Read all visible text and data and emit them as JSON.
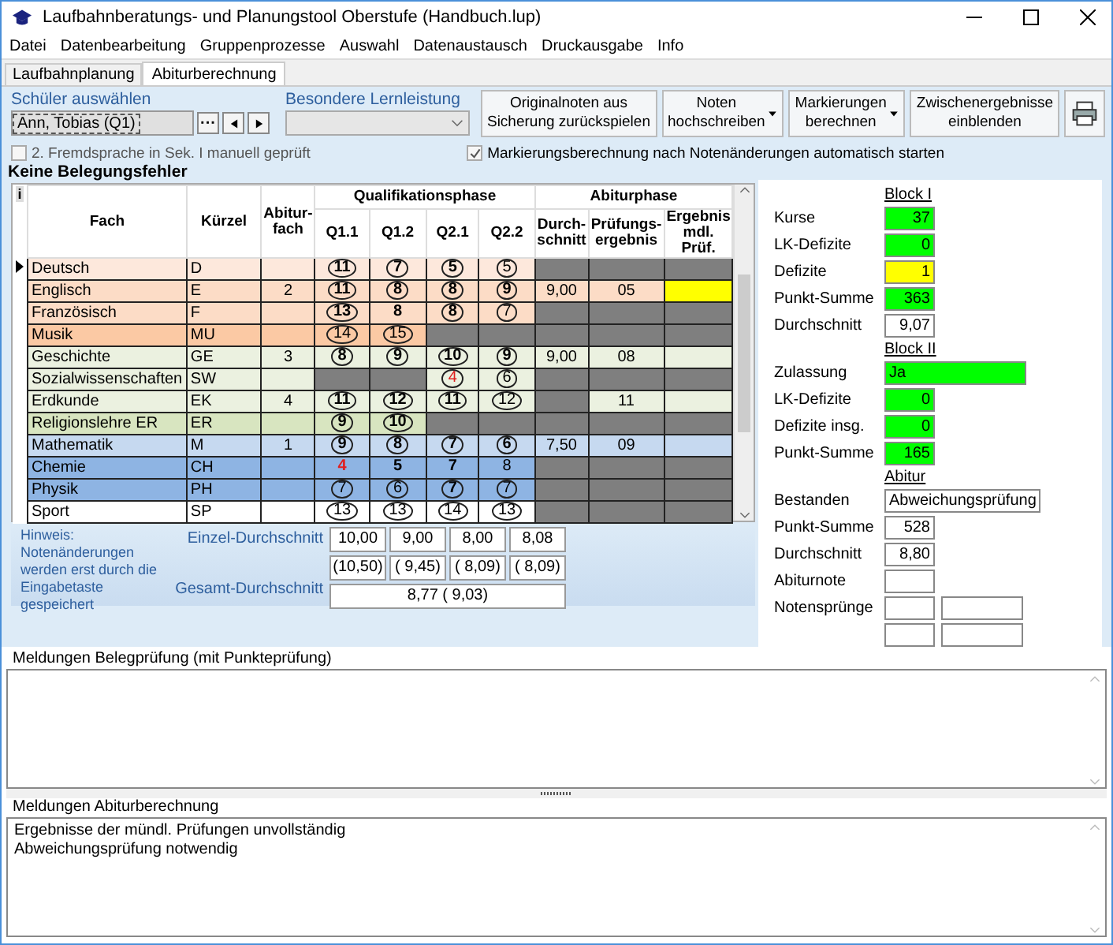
{
  "window": {
    "title": "Laufbahnberatungs- und Planungstool Oberstufe (Handbuch.lup)"
  },
  "menu": [
    "Datei",
    "Datenbearbeitung",
    "Gruppenprozesse",
    "Auswahl",
    "Datenaustausch",
    "Druckausgabe",
    "Info"
  ],
  "tabs": [
    {
      "label": "Laufbahnplanung",
      "selected": false
    },
    {
      "label": "Abiturberechnung",
      "selected": true
    }
  ],
  "student": {
    "label": "Schüler auswählen",
    "value": "Ann, Tobias (Q1)",
    "browse": "···"
  },
  "lernleistung": {
    "label": "Besondere Lernleistung",
    "disabled": true
  },
  "fremdsprache": {
    "label": "2. Fremdsprache in Sek. I manuell geprüft",
    "checked": false
  },
  "auto_calc": {
    "label": "Markierungsberechnung nach Notenänderungen automatisch starten",
    "checked": true
  },
  "buttons": [
    {
      "lines": [
        "Originalnoten aus",
        "Sicherung zurückspielen"
      ],
      "dropdown": false
    },
    {
      "lines": [
        "Noten",
        "hochschreiben"
      ],
      "dropdown": true
    },
    {
      "lines": [
        "Markierungen",
        "berechnen"
      ],
      "dropdown": true
    },
    {
      "lines": [
        "Zwischenergebnisse",
        "einblenden"
      ],
      "dropdown": false
    }
  ],
  "status": "Keine Belegungsfehler",
  "table": {
    "corner": "i",
    "columns": {
      "fach": "Fach",
      "kuerzel": "Kürzel",
      "abitur_fach": "Abitur-fach",
      "qphase": "Qualifikationsphase",
      "terms": [
        "Q1.1",
        "Q1.2",
        "Q2.1",
        "Q2.2"
      ],
      "aphase": "Abiturphase",
      "durchschnitt": "Durch-schnitt",
      "pruefung": "Prüfungs-ergebnis",
      "mdl": "Ergebnis mdl. Prüf."
    },
    "rows": [
      {
        "fach": "Deutsch",
        "kuerzel": "D",
        "color": "#fde8dc",
        "current": true,
        "grades": [
          {
            "kind": "grade",
            "value": "11",
            "circled": true,
            "bold": true,
            "deficit": false
          },
          {
            "kind": "grade",
            "value": "7",
            "circled": true,
            "bold": true,
            "deficit": false
          },
          {
            "kind": "grade",
            "value": "5",
            "circled": true,
            "bold": true,
            "deficit": false
          },
          {
            "kind": "grade",
            "value": "5",
            "circled": true,
            "bold": false,
            "deficit": false
          }
        ]
      },
      {
        "fach": "Englisch",
        "kuerzel": "E",
        "abitur_fach": "2",
        "color": "#fcdcc6",
        "current": false,
        "grades": [
          {
            "kind": "grade",
            "value": "11",
            "circled": true,
            "bold": true,
            "deficit": false
          },
          {
            "kind": "grade",
            "value": "8",
            "circled": true,
            "bold": true,
            "deficit": false
          },
          {
            "kind": "grade",
            "value": "8",
            "circled": true,
            "bold": true,
            "deficit": false
          },
          {
            "kind": "grade",
            "value": "9",
            "circled": true,
            "bold": true,
            "deficit": false
          }
        ],
        "abitur": {
          "durchschnitt": "9,00",
          "pruefung": "05",
          "mdl_required": true
        }
      },
      {
        "fach": "Französisch",
        "kuerzel": "F",
        "color": "#fcdcc6",
        "current": false,
        "grades": [
          {
            "kind": "grade",
            "value": "13",
            "circled": true,
            "bold": true,
            "deficit": false
          },
          {
            "kind": "grade",
            "value": "8",
            "circled": false,
            "bold": true,
            "deficit": false
          },
          {
            "kind": "grade",
            "value": "8",
            "circled": true,
            "bold": true,
            "deficit": false
          },
          {
            "kind": "grade",
            "value": "7",
            "circled": true,
            "bold": false,
            "deficit": false
          }
        ]
      },
      {
        "fach": "Musik",
        "kuerzel": "MU",
        "color": "#fbc9a4",
        "current": false,
        "grades": [
          {
            "kind": "grade",
            "value": "14",
            "circled": true,
            "bold": false,
            "deficit": false
          },
          {
            "kind": "grade",
            "value": "15",
            "circled": true,
            "bold": false,
            "deficit": false
          },
          {
            "kind": "blank"
          },
          {
            "kind": "blank"
          }
        ]
      },
      {
        "fach": "Geschichte",
        "kuerzel": "GE",
        "abitur_fach": "3",
        "color": "#ebf1e0",
        "current": false,
        "grades": [
          {
            "kind": "grade",
            "value": "8",
            "circled": true,
            "bold": true,
            "deficit": false
          },
          {
            "kind": "grade",
            "value": "9",
            "circled": true,
            "bold": true,
            "deficit": false
          },
          {
            "kind": "grade",
            "value": "10",
            "circled": true,
            "bold": true,
            "deficit": false
          },
          {
            "kind": "grade",
            "value": "9",
            "circled": true,
            "bold": true,
            "deficit": false
          }
        ],
        "abitur": {
          "durchschnitt": "9,00",
          "pruefung": "08",
          "mdl_required": false
        }
      },
      {
        "fach": "Sozialwissenschaften",
        "kuerzel": "SW",
        "color": "#ebf1e0",
        "current": false,
        "grades": [
          {
            "kind": "blank"
          },
          {
            "kind": "blank"
          },
          {
            "kind": "grade",
            "value": "4",
            "circled": true,
            "bold": false,
            "deficit": true
          },
          {
            "kind": "grade",
            "value": "6",
            "circled": true,
            "bold": false,
            "deficit": false
          }
        ]
      },
      {
        "fach": "Erdkunde",
        "kuerzel": "EK",
        "abitur_fach": "4",
        "color": "#ebf1e0",
        "current": false,
        "grades": [
          {
            "kind": "grade",
            "value": "11",
            "circled": true,
            "bold": true,
            "deficit": false
          },
          {
            "kind": "grade",
            "value": "12",
            "circled": true,
            "bold": true,
            "deficit": false
          },
          {
            "kind": "grade",
            "value": "11",
            "circled": true,
            "bold": true,
            "deficit": false
          },
          {
            "kind": "grade",
            "value": "12",
            "circled": true,
            "bold": false,
            "deficit": false
          }
        ],
        "abitur": {
          "pruefung": "11",
          "mdl_required": false
        }
      },
      {
        "fach": "Religionslehre ER",
        "kuerzel": "ER",
        "color": "#d8e5c0",
        "current": false,
        "grades": [
          {
            "kind": "grade",
            "value": "9",
            "circled": true,
            "bold": true,
            "deficit": false
          },
          {
            "kind": "grade",
            "value": "10",
            "circled": true,
            "bold": true,
            "deficit": false
          },
          {
            "kind": "blank"
          },
          {
            "kind": "blank"
          }
        ]
      },
      {
        "fach": "Mathematik",
        "kuerzel": "M",
        "abitur_fach": "1",
        "color": "#c6d9f0",
        "current": false,
        "grades": [
          {
            "kind": "grade",
            "value": "9",
            "circled": true,
            "bold": true,
            "deficit": false
          },
          {
            "kind": "grade",
            "value": "8",
            "circled": true,
            "bold": true,
            "deficit": false
          },
          {
            "kind": "grade",
            "value": "7",
            "circled": true,
            "bold": true,
            "deficit": false
          },
          {
            "kind": "grade",
            "value": "6",
            "circled": true,
            "bold": true,
            "deficit": false
          }
        ],
        "abitur": {
          "durchschnitt": "7,50",
          "pruefung": "09",
          "mdl_required": false
        }
      },
      {
        "fach": "Chemie",
        "kuerzel": "CH",
        "color": "#8eb4e3",
        "current": false,
        "grades": [
          {
            "kind": "grade",
            "value": "4",
            "circled": false,
            "bold": true,
            "deficit": true
          },
          {
            "kind": "grade",
            "value": "5",
            "circled": false,
            "bold": true,
            "deficit": false
          },
          {
            "kind": "grade",
            "value": "7",
            "circled": false,
            "bold": true,
            "deficit": false
          },
          {
            "kind": "grade",
            "value": "8",
            "circled": false,
            "bold": false,
            "deficit": false
          }
        ]
      },
      {
        "fach": "Physik",
        "kuerzel": "PH",
        "color": "#8eb4e3",
        "current": false,
        "grades": [
          {
            "kind": "grade",
            "value": "7",
            "circled": true,
            "bold": false,
            "deficit": false
          },
          {
            "kind": "grade",
            "value": "6",
            "circled": true,
            "bold": false,
            "deficit": false
          },
          {
            "kind": "grade",
            "value": "7",
            "circled": true,
            "bold": true,
            "deficit": false
          },
          {
            "kind": "grade",
            "value": "7",
            "circled": true,
            "bold": false,
            "deficit": false
          }
        ]
      },
      {
        "fach": "Sport",
        "kuerzel": "SP",
        "color": "#ffffff",
        "current": false,
        "grades": [
          {
            "kind": "grade",
            "value": "13",
            "circled": true,
            "bold": false,
            "deficit": false
          },
          {
            "kind": "grade",
            "value": "13",
            "circled": true,
            "bold": false,
            "deficit": false
          },
          {
            "kind": "grade",
            "value": "14",
            "circled": true,
            "bold": false,
            "deficit": false
          },
          {
            "kind": "grade",
            "value": "13",
            "circled": true,
            "bold": false,
            "deficit": false
          }
        ]
      }
    ]
  },
  "summary": {
    "hint": "Hinweis: Notenänderungen werden erst durch die Eingabetaste  gespeichert",
    "einzel_label": "Einzel-Durchschnitt",
    "einzel": [
      "10,00",
      "9,00",
      "8,00",
      "8,08"
    ],
    "einzel_alt": [
      "(10,50)",
      "( 9,45)",
      "( 8,09)",
      "( 8,09)"
    ],
    "gesamt_label": "Gesamt-Durchschnitt",
    "gesamt": "8,77 ( 9,03)"
  },
  "results": [
    {
      "kind": "heading",
      "label": "Block I"
    },
    {
      "kind": "field",
      "label": "Kurse",
      "value": "37",
      "color": "#00ff00"
    },
    {
      "kind": "field",
      "label": "LK-Defizite",
      "value": "0",
      "color": "#00ff00"
    },
    {
      "kind": "field",
      "label": "Defizite",
      "value": "1",
      "color": "#ffff00"
    },
    {
      "kind": "field",
      "label": "Punkt-Summe",
      "value": "363",
      "color": "#00ff00"
    },
    {
      "kind": "field",
      "label": "Durchschnitt",
      "value": "9,07",
      "color": "#ffffff"
    },
    {
      "kind": "heading",
      "label": "Block II"
    },
    {
      "kind": "wide",
      "label": "Zulassung",
      "value": "Ja",
      "color": "#00ff00"
    },
    {
      "kind": "field",
      "label": "LK-Defizite",
      "value": "0",
      "color": "#00ff00"
    },
    {
      "kind": "field",
      "label": "Defizite insg.",
      "value": "0",
      "color": "#00ff00"
    },
    {
      "kind": "field",
      "label": "Punkt-Summe",
      "value": "165",
      "color": "#00ff00"
    },
    {
      "kind": "heading",
      "label": "Abitur"
    },
    {
      "kind": "wide",
      "label": "Bestanden",
      "value": "Abweichungsprüfung",
      "color": "#ffffff"
    },
    {
      "kind": "field",
      "label": "Punkt-Summe",
      "value": "528",
      "color": "#ffffff"
    },
    {
      "kind": "field",
      "label": "Durchschnitt",
      "value": "8,80",
      "color": "#ffffff"
    },
    {
      "kind": "field",
      "label": "Abiturnote",
      "color": "#ffffff"
    },
    {
      "kind": "pair",
      "label": "Notensprünge"
    },
    {
      "kind": "pair"
    }
  ],
  "messages": [
    {
      "label": "Meldungen Belegprüfung (mit Punkteprüfung)"
    },
    {
      "label": "Meldungen Abiturberechnung",
      "lines": [
        "Ergebnisse der mündl. Prüfungen unvollständig",
        "Abweichungsprüfung notwendig"
      ]
    }
  ]
}
